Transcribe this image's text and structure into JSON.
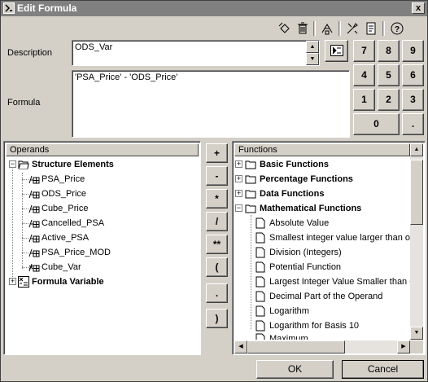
{
  "window": {
    "title": "Edit Formula",
    "close_label": "x"
  },
  "toolbar": {
    "icons": [
      "undo-icon",
      "delete-icon",
      "structure-icon",
      "tools-icon",
      "document-icon",
      "help-icon"
    ]
  },
  "description": {
    "label": "Description",
    "value": "ODS_Var"
  },
  "formula": {
    "label": "Formula",
    "value": "'PSA_Price' - 'ODS_Price'"
  },
  "keypad": {
    "keys": [
      "7",
      "8",
      "9",
      "4",
      "5",
      "6",
      "1",
      "2",
      "3",
      "0",
      "."
    ]
  },
  "operands": {
    "header": "Operands",
    "group1": "Structure Elements",
    "items": [
      "PSA_Price",
      "ODS_Price",
      "Cube_Price",
      "Cancelled_PSA",
      "Active_PSA",
      "PSA_Price_MOD",
      "Cube_Var"
    ],
    "group2": "Formula Variable"
  },
  "operators": [
    "+",
    "-",
    "*",
    "/",
    "**",
    "(",
    ".",
    ")"
  ],
  "functions": {
    "header": "Functions",
    "groups": [
      "Basic Functions",
      "Percentage Functions",
      "Data Functions",
      "Mathematical Functions"
    ],
    "items": [
      "Absolute Value",
      "Smallest integer value larger than ope",
      "Division (Integers)",
      "Potential Function",
      "Largest Integer Value Smaller than O",
      "Decimal Part of the Operand",
      "Logarithm",
      "Logarithm for Basis 10",
      "Maximum"
    ]
  },
  "footer": {
    "ok": "OK",
    "cancel": "Cancel"
  }
}
